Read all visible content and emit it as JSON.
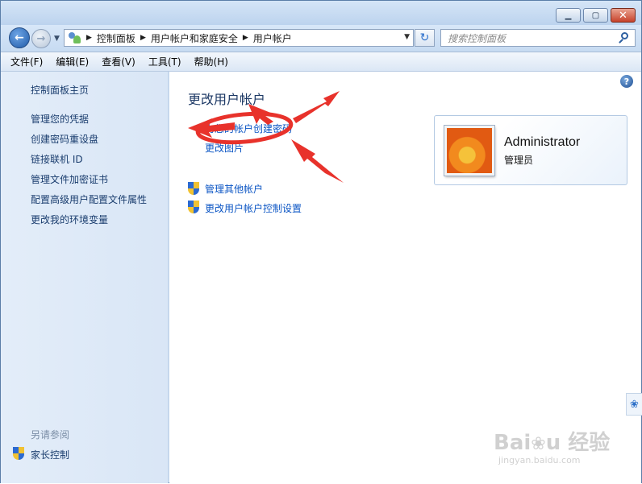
{
  "window": {
    "minimize_icon": "minimize-icon",
    "maximize_icon": "maximize-icon",
    "close_icon": "close-icon"
  },
  "address": {
    "crumbs": [
      "控制面板",
      "用户帐户和家庭安全",
      "用户帐户"
    ],
    "search_placeholder": "搜索控制面板"
  },
  "menu": {
    "items": [
      "文件(F)",
      "编辑(E)",
      "查看(V)",
      "工具(T)",
      "帮助(H)"
    ]
  },
  "sidebar": {
    "items": [
      "控制面板主页",
      "管理您的凭据",
      "创建密码重设盘",
      "链接联机 ID",
      "管理文件加密证书",
      "配置高级用户配置文件属性",
      "更改我的环境变量"
    ],
    "see_also_label": "另请参阅",
    "see_also_items": [
      "家长控制"
    ]
  },
  "main": {
    "title": "更改用户帐户",
    "links": [
      "为您的帐户创建密码",
      "更改图片"
    ],
    "shield_links": [
      "管理其他帐户",
      "更改用户帐户控制设置"
    ]
  },
  "account": {
    "name": "Administrator",
    "role": "管理员"
  },
  "annotation_color": "#e8322b",
  "watermark": {
    "logo": "Bai du 经验",
    "url": "jingyan.baidu.com"
  }
}
